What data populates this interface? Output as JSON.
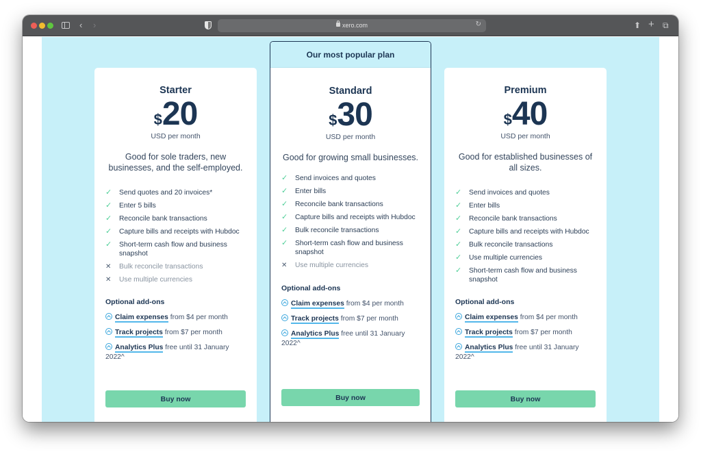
{
  "browser": {
    "url": "xero.com",
    "icons": {
      "sidebar": "sidebar-icon",
      "back": "chevron-left-icon",
      "forward": "chevron-right-icon",
      "privacy": "shield-icon",
      "lock": "lock-icon",
      "reload": "reload-icon",
      "share": "share-icon",
      "new_tab": "plus-icon",
      "tabs": "tabs-overview-icon"
    }
  },
  "colors": {
    "band_background": "#c7f0f9",
    "heading_navy": "#1c3553",
    "check_green": "#4fcf98",
    "buy_button": "#78d6ac",
    "link_underline": "#52b7ea"
  },
  "plans": [
    {
      "name": "Starter",
      "currency_symbol": "$",
      "price": "20",
      "period": "USD per month",
      "description": "Good for sole traders, new businesses, and the self-employed.",
      "features": [
        {
          "label": "Send quotes and 20 invoices*",
          "included": true
        },
        {
          "label": "Enter 5 bills",
          "included": true
        },
        {
          "label": "Reconcile bank transactions",
          "included": true
        },
        {
          "label": "Capture bills and receipts with Hubdoc",
          "included": true
        },
        {
          "label": "Short-term cash flow and business snapshot",
          "included": true
        },
        {
          "label": "Bulk reconcile transactions",
          "included": false
        },
        {
          "label": "Use multiple currencies",
          "included": false
        }
      ],
      "addons_title": "Optional add-ons",
      "addons": [
        {
          "name": "Claim expenses",
          "detail": "from $4 per month"
        },
        {
          "name": "Track projects",
          "detail": "from $7 per month"
        },
        {
          "name": "Analytics Plus",
          "detail": "free until 31 January 2022^"
        }
      ],
      "buy_label": "Buy now"
    },
    {
      "banner": "Our most popular plan",
      "name": "Standard",
      "currency_symbol": "$",
      "price": "30",
      "period": "USD per month",
      "description": "Good for growing small businesses.",
      "features": [
        {
          "label": "Send invoices and quotes",
          "included": true
        },
        {
          "label": "Enter bills",
          "included": true
        },
        {
          "label": "Reconcile bank transactions",
          "included": true
        },
        {
          "label": "Capture bills and receipts with Hubdoc",
          "included": true
        },
        {
          "label": "Bulk reconcile transactions",
          "included": true
        },
        {
          "label": "Short-term cash flow and business snapshot",
          "included": true
        },
        {
          "label": "Use multiple currencies",
          "included": false
        }
      ],
      "addons_title": "Optional add-ons",
      "addons": [
        {
          "name": "Claim expenses",
          "detail": "from $4 per month"
        },
        {
          "name": "Track projects",
          "detail": "from $7 per month"
        },
        {
          "name": "Analytics Plus",
          "detail": "free until 31 January 2022^"
        }
      ],
      "buy_label": "Buy now"
    },
    {
      "name": "Premium",
      "currency_symbol": "$",
      "price": "40",
      "period": "USD per month",
      "description": "Good for established businesses of all sizes.",
      "features": [
        {
          "label": "Send invoices and quotes",
          "included": true
        },
        {
          "label": "Enter bills",
          "included": true
        },
        {
          "label": "Reconcile bank transactions",
          "included": true
        },
        {
          "label": "Capture bills and receipts with Hubdoc",
          "included": true
        },
        {
          "label": "Bulk reconcile transactions",
          "included": true
        },
        {
          "label": "Use multiple currencies",
          "included": true
        },
        {
          "label": "Short-term cash flow and business snapshot",
          "included": true
        }
      ],
      "addons_title": "Optional add-ons",
      "addons": [
        {
          "name": "Claim expenses",
          "detail": "from $4 per month"
        },
        {
          "name": "Track projects",
          "detail": "from $7 per month"
        },
        {
          "name": "Analytics Plus",
          "detail": "free until 31 January 2022^"
        }
      ],
      "buy_label": "Buy now"
    }
  ]
}
